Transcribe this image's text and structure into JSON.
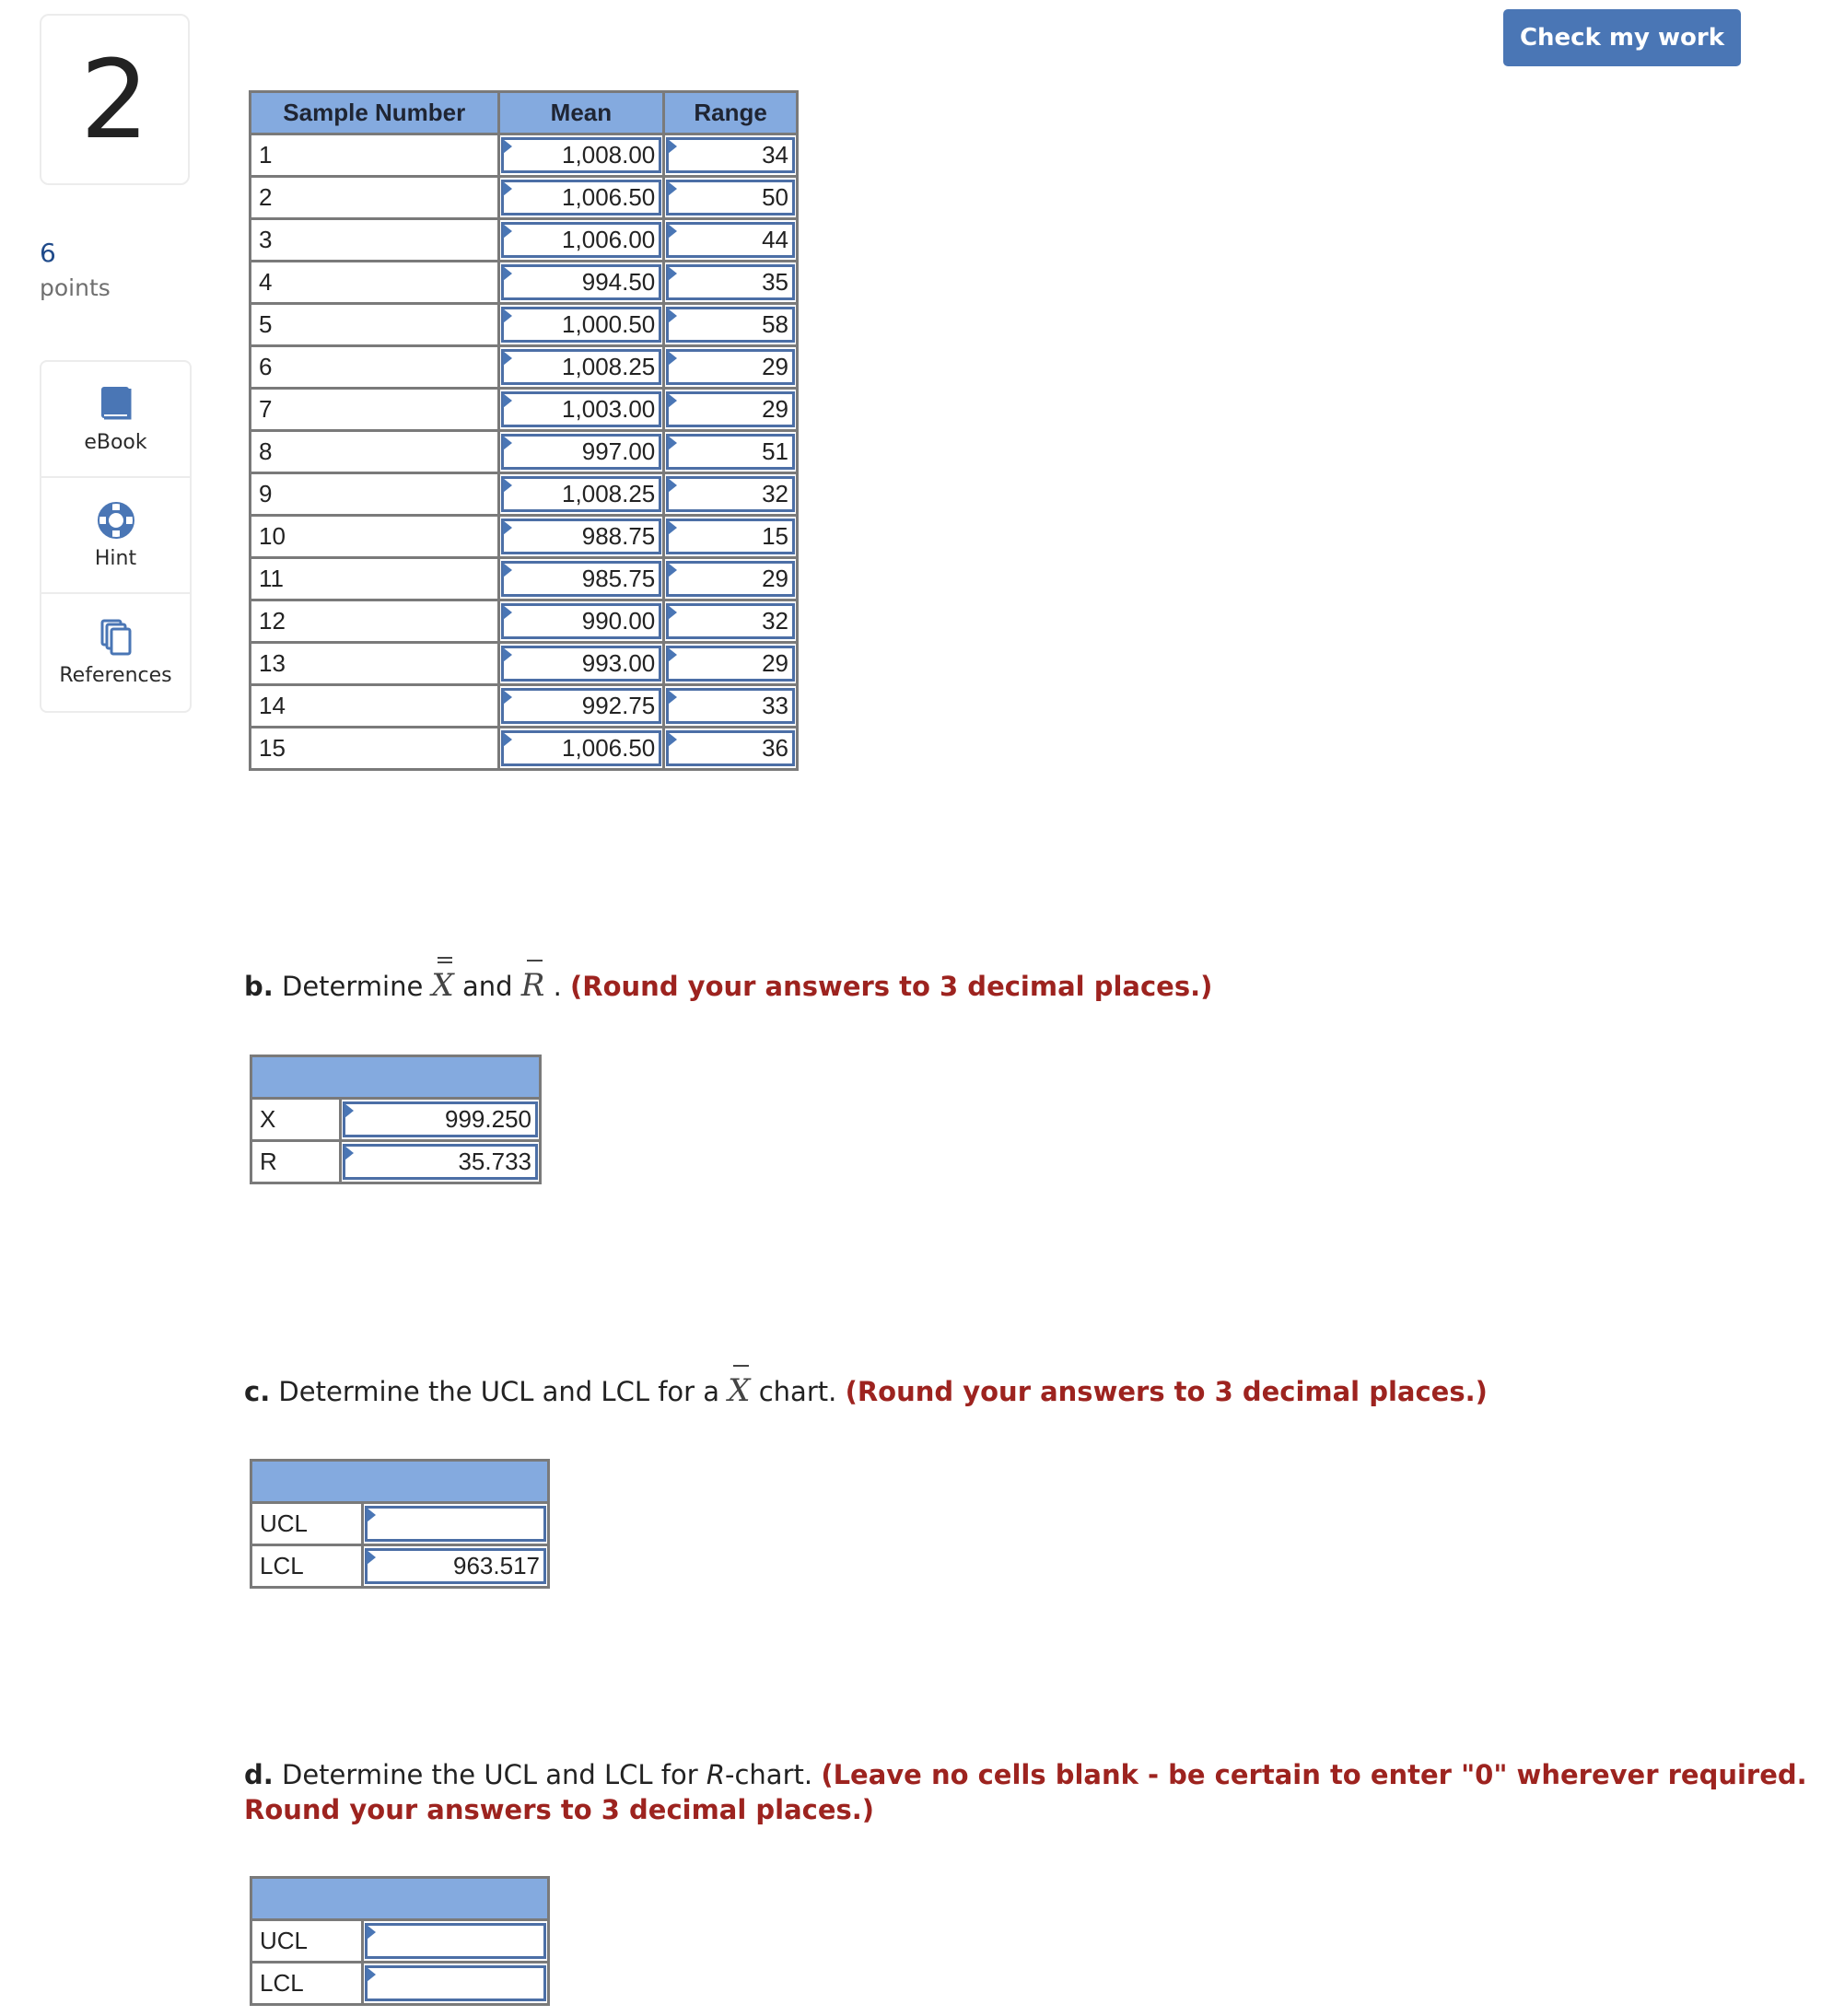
{
  "question": {
    "number": "2",
    "points_value": "6",
    "points_label": "points"
  },
  "tools": [
    {
      "label": "eBook",
      "icon": "book-icon"
    },
    {
      "label": "Hint",
      "icon": "lifebuoy-icon"
    },
    {
      "label": "References",
      "icon": "documents-icon"
    }
  ],
  "header": {
    "check_button": "Check my work"
  },
  "colors": {
    "accent": "#4a76b5",
    "table_header": "#84aadf",
    "instruction_red": "#9d231f",
    "points_blue": "#1f4a8a"
  },
  "data_table": {
    "columns": [
      "Sample Number",
      "Mean",
      "Range"
    ],
    "rows": [
      [
        "1",
        "1,008.00",
        "34"
      ],
      [
        "2",
        "1,006.50",
        "50"
      ],
      [
        "3",
        "1,006.00",
        "44"
      ],
      [
        "4",
        "994.50",
        "35"
      ],
      [
        "5",
        "1,000.50",
        "58"
      ],
      [
        "6",
        "1,008.25",
        "29"
      ],
      [
        "7",
        "1,003.00",
        "29"
      ],
      [
        "8",
        "997.00",
        "51"
      ],
      [
        "9",
        "1,008.25",
        "32"
      ],
      [
        "10",
        "988.75",
        "15"
      ],
      [
        "11",
        "985.75",
        "29"
      ],
      [
        "12",
        "990.00",
        "32"
      ],
      [
        "13",
        "993.00",
        "29"
      ],
      [
        "14",
        "992.75",
        "33"
      ],
      [
        "15",
        "1,006.50",
        "36"
      ]
    ]
  },
  "part_b": {
    "letter": "b.",
    "text_before": " Determine ",
    "sym1": "X",
    "text_mid": " and ",
    "sym2": "R",
    "text_after": " . ",
    "instruction": "(Round your answers to 3 decimal places.)",
    "rows": [
      {
        "label": "X",
        "value": "999.250"
      },
      {
        "label": "R",
        "value": "35.733"
      }
    ]
  },
  "part_c": {
    "letter": "c.",
    "text_before": " Determine the UCL and LCL for a ",
    "sym": "X",
    "text_after": " chart. ",
    "instruction": "(Round your answers to 3 decimal places.)",
    "rows": [
      {
        "label": "UCL",
        "value": ""
      },
      {
        "label": "LCL",
        "value": "963.517"
      }
    ]
  },
  "part_d": {
    "letter": "d.",
    "text_before": " Determine the UCL and LCL for ",
    "sym": "R",
    "text_after": "-chart. ",
    "instruction_line1": "(Leave no cells blank - be certain to enter \"0\" wherever required.",
    "instruction_line2": "Round your answers to 3 decimal places.)",
    "rows": [
      {
        "label": "UCL",
        "value": ""
      },
      {
        "label": "LCL",
        "value": ""
      }
    ]
  }
}
